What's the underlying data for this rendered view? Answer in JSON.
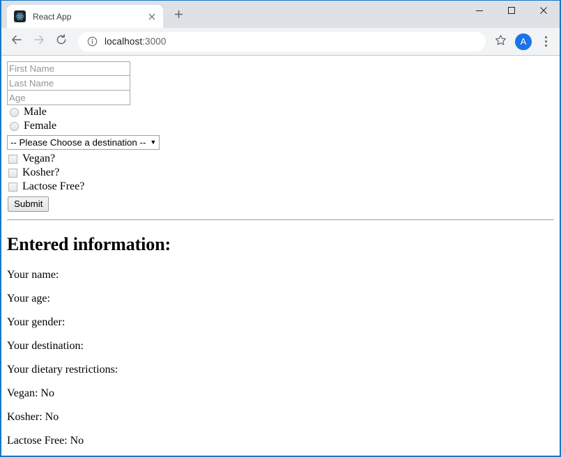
{
  "browser": {
    "tab": {
      "title": "React App",
      "favicon_icon": "react-logo-icon",
      "close_icon": "close-icon"
    },
    "new_tab_icon": "plus-icon",
    "window_controls": {
      "minimize_icon": "minimize-icon",
      "maximize_icon": "maximize-icon",
      "close_icon": "close-icon"
    },
    "toolbar": {
      "back_icon": "back-arrow-icon",
      "forward_icon": "forward-arrow-icon",
      "reload_icon": "reload-icon",
      "site_info_icon": "info-circle-icon",
      "url_host": "localhost",
      "url_port": ":3000",
      "bookmark_icon": "star-icon",
      "avatar_initial": "A",
      "avatar_color": "#1a73e8",
      "menu_icon": "three-dots-icon"
    }
  },
  "page": {
    "form": {
      "first_name": {
        "value": "",
        "placeholder": "First Name"
      },
      "last_name": {
        "value": "",
        "placeholder": "Last Name"
      },
      "age": {
        "value": "",
        "placeholder": "Age"
      },
      "gender": {
        "options": [
          {
            "label": "Male",
            "checked": false
          },
          {
            "label": "Female",
            "checked": false
          }
        ]
      },
      "destination": {
        "selected": "-- Please Choose a destination --",
        "arrow_glyph": "▼"
      },
      "dietary": [
        {
          "label": "Vegan?",
          "checked": false
        },
        {
          "label": "Kosher?",
          "checked": false
        },
        {
          "label": "Lactose Free?",
          "checked": false
        }
      ],
      "submit_label": "Submit"
    },
    "results": {
      "heading": "Entered information:",
      "lines": [
        "Your name:",
        "Your age:",
        "Your gender:",
        "Your destination:",
        "Your dietary restrictions:",
        "Vegan: No",
        "Kosher: No",
        "Lactose Free: No"
      ]
    }
  }
}
